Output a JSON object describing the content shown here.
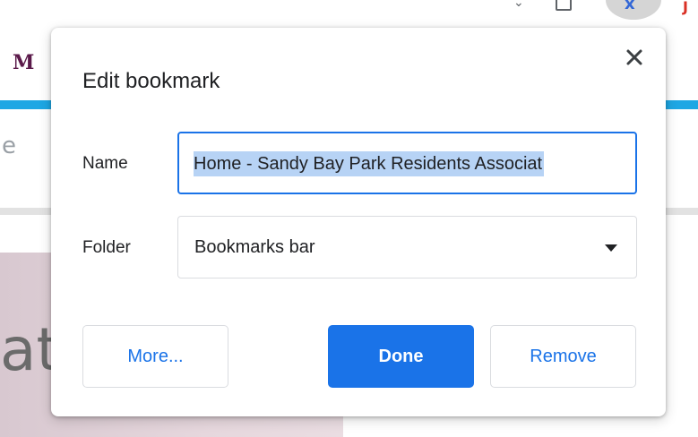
{
  "background": {
    "favicon_letter": "M",
    "nav_letter": "e",
    "hero_text": "at"
  },
  "dialog": {
    "title": "Edit bookmark",
    "close_icon": "close-icon",
    "name_label": "Name",
    "name_value": "Home - Sandy Bay Park Residents Associat",
    "folder_label": "Folder",
    "folder_value": "Bookmarks bar",
    "dropdown_icon": "chevron-down-icon",
    "buttons": {
      "more": "More...",
      "done": "Done",
      "remove": "Remove"
    }
  },
  "colors": {
    "accent": "#1a73e8",
    "selection": "#b7d3f5",
    "text": "#202124"
  }
}
